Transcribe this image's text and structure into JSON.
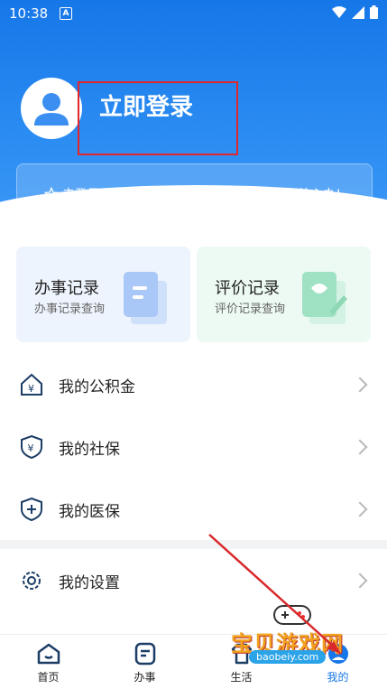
{
  "status": {
    "time": "10:38",
    "notif_badge": "A"
  },
  "header": {
    "login_title": "立即登录",
    "banner_left": "未登录",
    "banner_right": "铁定办，放心办!"
  },
  "quick": [
    {
      "title": "办事记录",
      "sub": "办事记录查询",
      "bg": "#eef4fd",
      "icon": "document-icon"
    },
    {
      "title": "评价记录",
      "sub": "评价记录查询",
      "bg": "#ecfaf3",
      "icon": "evaluation-icon"
    }
  ],
  "list": [
    {
      "label": "我的公积金",
      "icon": "housing-fund-icon"
    },
    {
      "label": "我的社保",
      "icon": "social-security-icon"
    },
    {
      "label": "我的医保",
      "icon": "medical-insurance-icon"
    },
    {
      "label": "我的设置",
      "icon": "settings-gear-icon"
    }
  ],
  "tabs": [
    {
      "label": "首页",
      "icon": "home-icon"
    },
    {
      "label": "办事",
      "icon": "affairs-icon"
    },
    {
      "label": "生活",
      "icon": "life-icon"
    },
    {
      "label": "我的",
      "icon": "profile-icon"
    }
  ],
  "watermark": {
    "text": "宝贝游戏网",
    "url": "baobeiy.com"
  },
  "colors": {
    "primary": "#1677e8",
    "highlight": "#e0262f",
    "arrow": "#d8282b"
  }
}
